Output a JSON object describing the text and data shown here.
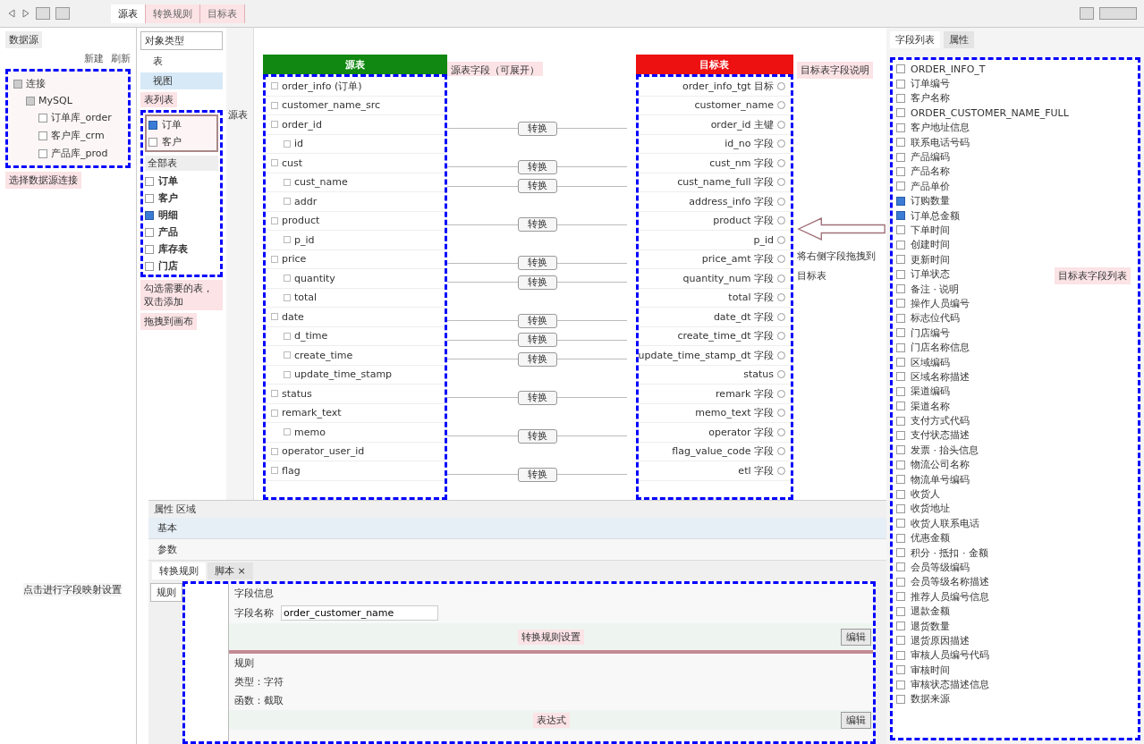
{
  "toolbar": {
    "tabs": [
      {
        "label": "源表",
        "selected": true
      },
      {
        "label": "转换规则",
        "selected": false
      },
      {
        "label": "目标表",
        "selected": false
      }
    ]
  },
  "datasource_panel": {
    "title": "数据源",
    "actions": [
      "新建",
      "刷新"
    ],
    "tree": [
      {
        "label": "连接",
        "expanded": true,
        "children": [
          {
            "label": "MySQL",
            "expanded": true,
            "children": [
              {
                "label": "订单库_order"
              },
              {
                "label": "客户库_crm"
              },
              {
                "label": "产品库_prod"
              }
            ]
          }
        ]
      }
    ],
    "note": "选择数据源连接"
  },
  "table_panel": {
    "selector": "对象类型",
    "types": [
      {
        "label": "表",
        "selected": false
      },
      {
        "label": "视图",
        "selected": true
      }
    ],
    "list_title": "表列表",
    "picked": [
      {
        "label": "订单",
        "checked": true
      },
      {
        "label": "客户",
        "checked": false
      }
    ],
    "list_header": "全部表",
    "items": [
      {
        "label": "订单",
        "checked": false
      },
      {
        "label": "客户",
        "checked": false
      },
      {
        "label": "明细",
        "checked": true
      },
      {
        "label": "产品",
        "checked": false
      },
      {
        "label": "库存表",
        "checked": false
      },
      {
        "label": "门店",
        "checked": false
      }
    ],
    "notes": [
      "勾选需要的表，双击添加",
      "拖拽到画布"
    ],
    "side_note": "源表"
  },
  "source_table": {
    "title": "源表",
    "rows": [
      {
        "label": "order_info (订单)",
        "children": []
      },
      {
        "label": "customer_name_src",
        "children": []
      },
      {
        "label": "order_id",
        "children": [
          {
            "label": "id"
          }
        ]
      },
      {
        "label": "cust",
        "children": [
          {
            "label": "cust_name"
          },
          {
            "label": "addr"
          }
        ]
      },
      {
        "label": "product",
        "children": [
          {
            "label": "p_id"
          }
        ]
      },
      {
        "label": "price",
        "children": [
          {
            "label": "quantity"
          },
          {
            "label": "total"
          }
        ]
      },
      {
        "label": "date",
        "children": [
          {
            "label": "d_time"
          },
          {
            "label": "create_time"
          },
          {
            "label": "update_time_stamp"
          }
        ]
      },
      {
        "label": "status",
        "children": []
      },
      {
        "label": "remark_text",
        "children": [
          {
            "label": "memo"
          }
        ]
      },
      {
        "label": "operator_user_id",
        "children": []
      },
      {
        "label": "flag",
        "children": []
      }
    ]
  },
  "source_note": "源表字段（可展开）",
  "mapping": [
    {
      "mapped": false
    },
    {
      "mapped": false
    },
    {
      "mapped": true,
      "action": "转换"
    },
    {
      "mapped": false
    },
    {
      "mapped": true,
      "action": "转换"
    },
    {
      "mapped": true,
      "action": "转换"
    },
    {
      "mapped": false
    },
    {
      "mapped": true,
      "action": "转换"
    },
    {
      "mapped": false
    },
    {
      "mapped": true,
      "action": "转换"
    },
    {
      "mapped": true,
      "action": "转换"
    },
    {
      "mapped": false
    },
    {
      "mapped": true,
      "action": "转换"
    },
    {
      "mapped": true,
      "action": "转换"
    },
    {
      "mapped": true,
      "action": "转换"
    },
    {
      "mapped": false
    },
    {
      "mapped": true,
      "action": "转换"
    },
    {
      "mapped": false
    },
    {
      "mapped": true,
      "action": "转换"
    },
    {
      "mapped": false
    },
    {
      "mapped": true,
      "action": "转换"
    }
  ],
  "target_table": {
    "title": "目标表",
    "rows": [
      "order_info_tgt 目标",
      "customer_name",
      "order_id 主键",
      "id_no 字段",
      "cust_nm 字段",
      "cust_name_full 字段",
      "address_info 字段",
      "product 字段",
      "p_id",
      "price_amt 字段",
      "quantity_num 字段",
      "total 字段",
      "date_dt 字段",
      "create_time_dt 字段",
      "update_time_stamp_dt 字段",
      "status",
      "remark 字段",
      "memo_text 字段",
      "operator 字段",
      "flag_value_code 字段",
      "etl 字段"
    ]
  },
  "target_note": "目标表字段说明",
  "drag_note": [
    "将右侧字段拖拽到",
    "目标表"
  ],
  "field_panel": {
    "tabs": [
      {
        "label": "字段列表",
        "selected": true
      },
      {
        "label": "属性",
        "selected": false
      }
    ],
    "items": [
      {
        "label": "ORDER_INFO_T",
        "checked": false
      },
      {
        "label": "订单编号",
        "checked": false
      },
      {
        "label": "客户名称",
        "checked": false
      },
      {
        "label": "ORDER_CUSTOMER_NAME_FULL",
        "checked": false
      },
      {
        "label": "客户地址信息",
        "checked": false
      },
      {
        "label": "联系电话号码",
        "checked": false
      },
      {
        "label": "产品编码",
        "checked": false
      },
      {
        "label": "产品名称",
        "checked": false
      },
      {
        "label": "产品单价",
        "checked": false
      },
      {
        "label": "订购数量",
        "checked": true
      },
      {
        "label": "订单总金额",
        "checked": true
      },
      {
        "label": "下单时间",
        "checked": false
      },
      {
        "label": "创建时间",
        "checked": false
      },
      {
        "label": "更新时间",
        "checked": false
      },
      {
        "label": "订单状态",
        "checked": false
      },
      {
        "label": "备注 · 说明",
        "checked": false
      },
      {
        "label": "操作人员编号",
        "checked": false
      },
      {
        "label": "标志位代码",
        "checked": false
      },
      {
        "label": "门店编号",
        "checked": false
      },
      {
        "label": "门店名称信息",
        "checked": false
      },
      {
        "label": "区域编码",
        "checked": false
      },
      {
        "label": "区域名称描述",
        "checked": false
      },
      {
        "label": "渠道编码",
        "checked": false
      },
      {
        "label": "渠道名称",
        "checked": false
      },
      {
        "label": "支付方式代码",
        "checked": false
      },
      {
        "label": "支付状态描述",
        "checked": false
      },
      {
        "label": "发票 · 抬头信息",
        "checked": false
      },
      {
        "label": "物流公司名称",
        "checked": false
      },
      {
        "label": "物流单号编码",
        "checked": false
      },
      {
        "label": "收货人",
        "checked": false
      },
      {
        "label": "收货地址",
        "checked": false
      },
      {
        "label": "收货人联系电话",
        "checked": false
      },
      {
        "label": "优惠金额",
        "checked": false
      },
      {
        "label": "积分 · 抵扣 · 金额",
        "checked": false
      },
      {
        "label": "会员等级编码",
        "checked": false
      },
      {
        "label": "会员等级名称描述",
        "checked": false
      },
      {
        "label": "推荐人员编号信息",
        "checked": false
      },
      {
        "label": "退款金额",
        "checked": false
      },
      {
        "label": "退货数量",
        "checked": false
      },
      {
        "label": "退货原因描述",
        "checked": false
      },
      {
        "label": "审核人员编号代码",
        "checked": false
      },
      {
        "label": "审核时间",
        "checked": false
      },
      {
        "label": "审核状态描述信息",
        "checked": false
      },
      {
        "label": "数据来源",
        "checked": false
      }
    ],
    "note": "目标表字段列表"
  },
  "bottom_panel": {
    "title": "属性 区域",
    "tabs": [
      {
        "label": "基本",
        "selected": true
      },
      {
        "label": "参数",
        "selected": false
      }
    ],
    "subtabs": [
      {
        "label": "转换规则",
        "selected": true
      },
      {
        "label": "脚本 ×",
        "selected": false
      }
    ],
    "left_note": "点击进行字段映射设置",
    "left_button": "规则",
    "form_title": "字段信息",
    "field_label": "字段名称",
    "field_value": "order_customer_name",
    "section": "转换规则设置",
    "section_button": "编辑",
    "highlight": "规则",
    "type_line": "类型：字符",
    "func_line": "函数：截取",
    "footer": "表达式",
    "footer_button": "编辑"
  }
}
